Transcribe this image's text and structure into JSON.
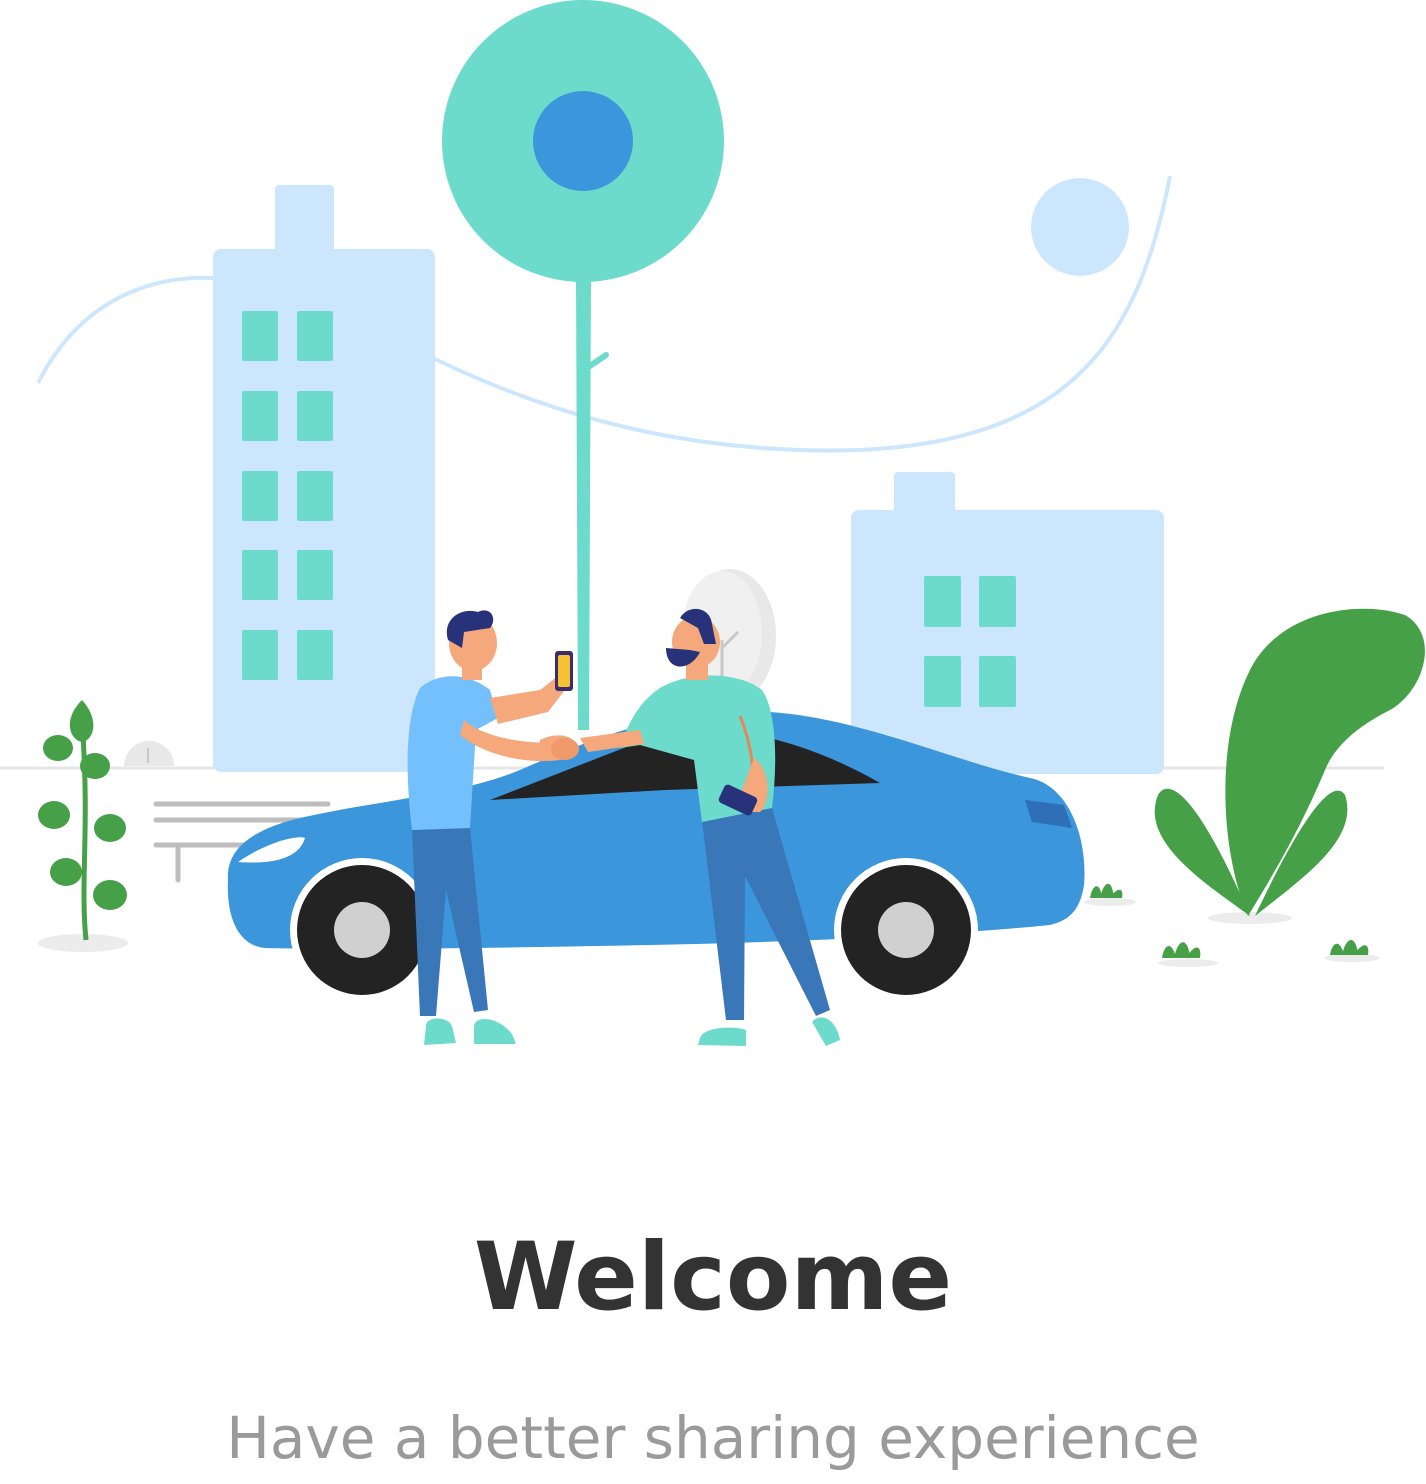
{
  "onboarding": {
    "title": "Welcome",
    "subtitle": "Have a better sharing experience"
  },
  "illustration": {
    "subject": "two people shaking hands next to a shared car in a city",
    "icons": [
      "city-building-icon",
      "tree-icon",
      "car-icon",
      "person-icon",
      "plant-icon",
      "bench-icon",
      "phone-icon"
    ]
  },
  "colors": {
    "title": "#333333",
    "subtitle": "#9a9a9a",
    "car_body": "#3b96dc",
    "building": "#cce7fd",
    "window": "#6ddbcb",
    "tree_canopy": "#6ddbcb",
    "tree_center": "#3b96dc",
    "plant": "#46a047",
    "shirt_left": "#74c0fc",
    "shirt_right": "#6ddbcb",
    "pants": "#3a77b9",
    "wheel": "#232323",
    "hubcap": "#d0d0d0"
  }
}
